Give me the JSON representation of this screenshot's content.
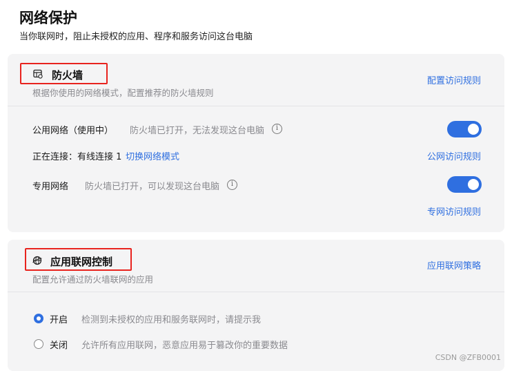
{
  "header": {
    "title": "网络保护",
    "subtitle": "当你联网时，阻止未授权的应用、程序和服务访问这台电脑"
  },
  "firewall": {
    "title": "防火墙",
    "icon": "firewall-icon",
    "description": "根据你使用的网络模式，配置推荐的防火墙规则",
    "config_link": "配置访问规则",
    "public": {
      "label": "公用网络（使用中）",
      "status": "防火墙已打开，无法发现这台电脑",
      "enabled": true,
      "connection_label": "正在连接：有线连接 1",
      "switch_link": "切换网络模式",
      "rules_link": "公网访问规则"
    },
    "private": {
      "label": "专用网络",
      "status": "防火墙已打开，可以发现这台电脑",
      "enabled": true,
      "rules_link": "专网访问规则"
    }
  },
  "app_control": {
    "title": "应用联网控制",
    "icon": "globe-shield-icon",
    "description": "配置允许通过防火墙联网的应用",
    "policy_link": "应用联网策略",
    "options": [
      {
        "label": "开启",
        "description": "检测到未授权的应用和服务联网时，请提示我",
        "selected": true
      },
      {
        "label": "关闭",
        "description": "允许所有应用联网，恶意应用易于篡改你的重要数据",
        "selected": false
      }
    ]
  },
  "watermark": "CSDN @ZFB0001",
  "colors": {
    "accent": "#2f6fe0",
    "highlight_border": "#e8231e",
    "card_bg": "#f4f4f5"
  }
}
